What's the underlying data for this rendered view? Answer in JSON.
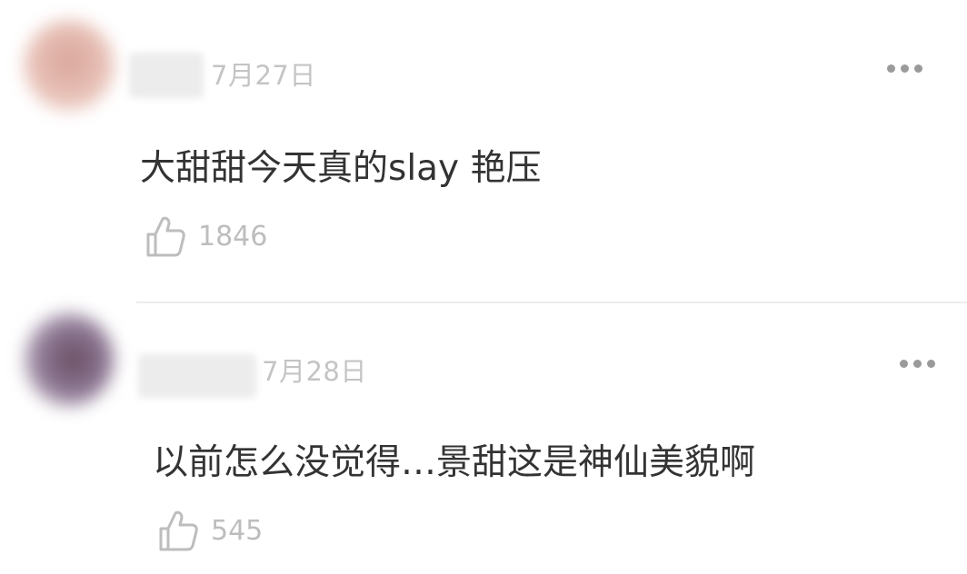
{
  "comments": [
    {
      "date": "7月27日",
      "text": "大甜甜今天真的slay 艳压",
      "likes": "1846",
      "avatar_color": "#d9a49a",
      "more_icon": "more-dots-icon",
      "like_icon": "thumbs-up-icon"
    },
    {
      "date": "7月28日",
      "text": "以前怎么没觉得…景甜这是神仙美貌啊",
      "likes": "545",
      "avatar_color": "#6a4f63",
      "more_icon": "more-dots-icon",
      "like_icon": "thumbs-up-icon"
    }
  ],
  "colors": {
    "text": "#333333",
    "meta": "#c4c4c4",
    "divider": "#ececec"
  }
}
